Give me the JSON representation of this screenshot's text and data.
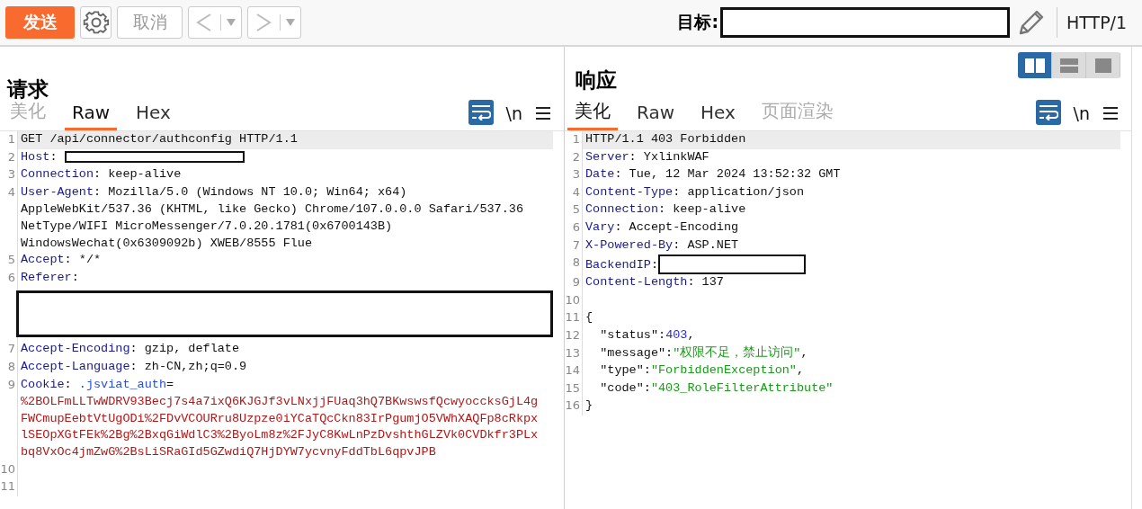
{
  "toolbar": {
    "send": "发送",
    "cancel": "取消",
    "cancel_disabled": true,
    "target_label": "目标:",
    "protocol": "HTTP/1"
  },
  "layout_buttons": [
    {
      "kind": "columns",
      "selected": true
    },
    {
      "kind": "rows",
      "selected": false
    },
    {
      "kind": "single",
      "selected": false
    }
  ],
  "panes": [
    {
      "title": "请求",
      "tabs": [
        {
          "label": "美化",
          "selected": false,
          "disabled": true
        },
        {
          "label": "Raw",
          "selected": true,
          "disabled": false
        },
        {
          "label": "Hex",
          "selected": false,
          "disabled": false
        }
      ],
      "wrap_on": true,
      "newline_label": "\\n",
      "lines": [
        {
          "number": "1",
          "highlighted": true,
          "parts": [
            {
              "kind": "plain",
              "text": "GET /api/connector/authconfig HTTP/1.1"
            }
          ]
        },
        {
          "number": "2",
          "highlighted": false,
          "parts": [
            {
              "kind": "name",
              "text": "Host"
            },
            {
              "kind": "plain",
              "text": ": "
            },
            {
              "kind": "redact"
            }
          ]
        },
        {
          "number": "3",
          "highlighted": false,
          "parts": [
            {
              "kind": "name",
              "text": "Connection"
            },
            {
              "kind": "plain",
              "text": ": keep-alive"
            }
          ]
        },
        {
          "number": "4",
          "highlighted": false,
          "parts": [
            {
              "kind": "name",
              "text": "User-Agent"
            },
            {
              "kind": "plain",
              "text": ": Mozilla/5.0 (Windows NT 10.0; Win64; x64)"
            }
          ]
        },
        {
          "highlighted": false,
          "parts": [
            {
              "kind": "plain",
              "text": "AppleWebKit/537.36 (KHTML, like Gecko) Chrome/107.0.0.0 Safari/537.36"
            }
          ]
        },
        {
          "highlighted": false,
          "parts": [
            {
              "kind": "plain",
              "text": "NetType/WIFI MicroMessenger/7.0.20.1781(0x6700143B)"
            }
          ]
        },
        {
          "highlighted": false,
          "parts": [
            {
              "kind": "plain",
              "text": "WindowsWechat(0x6309092b) XWEB/8555 Flue"
            }
          ]
        },
        {
          "number": "5",
          "highlighted": false,
          "parts": [
            {
              "kind": "name",
              "text": "Accept"
            },
            {
              "kind": "plain",
              "text": ": */*"
            }
          ]
        },
        {
          "number": "6",
          "highlighted": false,
          "parts": [
            {
              "kind": "name",
              "text": "Referer"
            },
            {
              "kind": "plain",
              "text": ":"
            }
          ]
        },
        {
          "highlighted": false,
          "parts": [
            {
              "kind": "redact-block"
            }
          ]
        },
        {
          "number": "7",
          "highlighted": false,
          "parts": [
            {
              "kind": "name",
              "text": "Accept-Encoding"
            },
            {
              "kind": "plain",
              "text": ": gzip, deflate"
            }
          ]
        },
        {
          "number": "8",
          "highlighted": false,
          "parts": [
            {
              "kind": "name",
              "text": "Accept-Language"
            },
            {
              "kind": "plain",
              "text": ": zh-CN,zh;q=0.9"
            }
          ]
        },
        {
          "number": "9",
          "highlighted": false,
          "parts": [
            {
              "kind": "name",
              "text": "Cookie"
            },
            {
              "kind": "plain",
              "text": ": "
            },
            {
              "kind": "cookie-name",
              "text": ".jsviat_auth"
            },
            {
              "kind": "plain",
              "text": "="
            }
          ]
        },
        {
          "highlighted": false,
          "parts": [
            {
              "kind": "value",
              "text": "%2BOLFmLLTwWDRV93Becj7s4a7ixQ6KJGJf3vLNxjjFUaq3hQ7BKwswsfQcwyoccksGjL4g"
            }
          ]
        },
        {
          "highlighted": false,
          "parts": [
            {
              "kind": "value",
              "text": "FWCmupEebtVtUgODi%2FDvVCOURru8Uzpze0iYCaTQcCkn83IrPgumjO5VWhXAQFp8cRkpx"
            }
          ]
        },
        {
          "highlighted": false,
          "parts": [
            {
              "kind": "value",
              "text": "lSEOpXGtFEk%2Bg%2BxqGiWdlC3%2ByoLm8z%2FJyC8KwLnPzDvshthGLZVk0CVDkfr3PLx"
            }
          ]
        },
        {
          "highlighted": false,
          "parts": [
            {
              "kind": "value",
              "text": "bq8VxOc4jmZwG%2BsLiSRaGId5GZwdiQ7HjDYW7ycvnyFddTbL6qpvJPB"
            }
          ]
        },
        {
          "number": "10",
          "highlighted": false
        },
        {
          "number": "11",
          "highlighted": false
        }
      ]
    },
    {
      "title": "响应",
      "tabs": [
        {
          "label": "美化",
          "selected": true,
          "disabled": false
        },
        {
          "label": "Raw",
          "selected": false,
          "disabled": false
        },
        {
          "label": "Hex",
          "selected": false,
          "disabled": false
        },
        {
          "label": "页面渲染",
          "selected": false,
          "disabled": true
        }
      ],
      "wrap_on": true,
      "newline_label": "\\n",
      "lines": [
        {
          "number": "1",
          "highlighted": true,
          "parts": [
            {
              "kind": "plain",
              "text": "HTTP/1.1 403 Forbidden"
            }
          ]
        },
        {
          "number": "2",
          "highlighted": false,
          "parts": [
            {
              "kind": "name",
              "text": "Server"
            },
            {
              "kind": "plain",
              "text": ": YxlinkWAF"
            }
          ]
        },
        {
          "number": "3",
          "highlighted": false,
          "parts": [
            {
              "kind": "name",
              "text": "Date"
            },
            {
              "kind": "plain",
              "text": ": Tue, 12 Mar 2024 13:52:32 GMT"
            }
          ]
        },
        {
          "number": "4",
          "highlighted": false,
          "parts": [
            {
              "kind": "name",
              "text": "Content-Type"
            },
            {
              "kind": "plain",
              "text": ": application/json"
            }
          ]
        },
        {
          "number": "5",
          "highlighted": false,
          "parts": [
            {
              "kind": "name",
              "text": "Connection"
            },
            {
              "kind": "plain",
              "text": ": keep-alive"
            }
          ]
        },
        {
          "number": "6",
          "highlighted": false,
          "parts": [
            {
              "kind": "name",
              "text": "Vary"
            },
            {
              "kind": "plain",
              "text": ": Accept-Encoding"
            }
          ]
        },
        {
          "number": "7",
          "highlighted": false,
          "parts": [
            {
              "kind": "name",
              "text": "X-Powered-By"
            },
            {
              "kind": "plain",
              "text": ": ASP.NET"
            }
          ]
        },
        {
          "number": "8",
          "highlighted": false,
          "parts": [
            {
              "kind": "name",
              "text": "BackendIP"
            },
            {
              "kind": "plain",
              "text": ":"
            },
            {
              "kind": "redact"
            }
          ]
        },
        {
          "number": "9",
          "highlighted": false,
          "parts": [
            {
              "kind": "name",
              "text": "Content-Length"
            },
            {
              "kind": "plain",
              "text": ": 137"
            }
          ]
        },
        {
          "number": "10",
          "highlighted": false
        },
        {
          "number": "11",
          "highlighted": false,
          "parts": [
            {
              "kind": "plain",
              "text": "{"
            }
          ]
        },
        {
          "number": "12",
          "highlighted": false,
          "parts": [
            {
              "kind": "plain",
              "text": "  \"status\":"
            },
            {
              "kind": "num",
              "text": "403"
            },
            {
              "kind": "plain",
              "text": ","
            }
          ]
        },
        {
          "number": "13",
          "highlighted": false,
          "parts": [
            {
              "kind": "plain",
              "text": "  \"message\":"
            },
            {
              "kind": "str",
              "text": "\"权限不足，禁止访问\""
            },
            {
              "kind": "plain",
              "text": ","
            }
          ]
        },
        {
          "number": "14",
          "highlighted": false,
          "parts": [
            {
              "kind": "plain",
              "text": "  \"type\":"
            },
            {
              "kind": "str",
              "text": "\"ForbiddenException\""
            },
            {
              "kind": "plain",
              "text": ","
            }
          ]
        },
        {
          "number": "15",
          "highlighted": false,
          "parts": [
            {
              "kind": "plain",
              "text": "  \"code\":"
            },
            {
              "kind": "str",
              "text": "\"403_RoleFilterAttribute\""
            }
          ]
        },
        {
          "number": "16",
          "highlighted": false,
          "parts": [
            {
              "kind": "plain",
              "text": "}"
            }
          ]
        }
      ]
    }
  ]
}
